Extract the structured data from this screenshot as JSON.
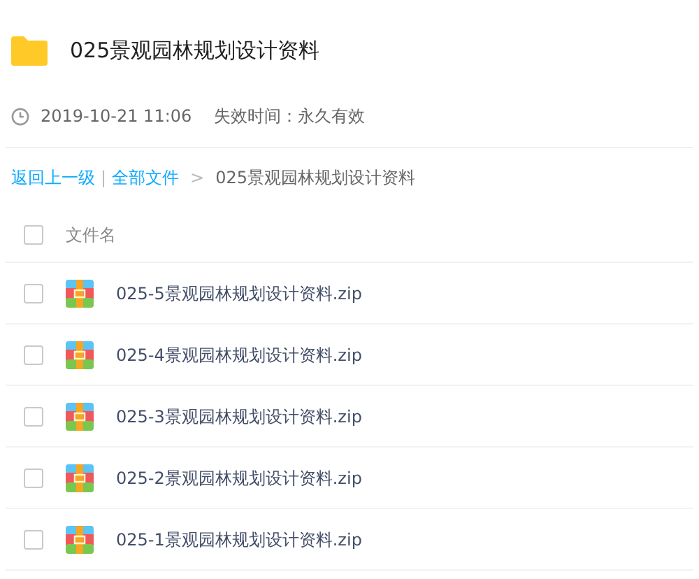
{
  "title": "025景观园林规划设计资料",
  "meta": {
    "date": "2019-10-21 11:06",
    "expiry": "失效时间：永久有效"
  },
  "breadcrumb": {
    "back": "返回上一级",
    "separator": "|",
    "all": "全部文件",
    "arrow": ">",
    "current": "025景观园林规划设计资料"
  },
  "list_header": {
    "label": "文件名",
    "checked": false
  },
  "files": [
    {
      "name": "025-5景观园林规划设计资料.zip",
      "checked": false
    },
    {
      "name": "025-4景观园林规划设计资料.zip",
      "checked": false
    },
    {
      "name": "025-3景观园林规划设计资料.zip",
      "checked": false
    },
    {
      "name": "025-2景观园林规划设计资料.zip",
      "checked": false
    },
    {
      "name": "025-1景观园林规划设计资料.zip",
      "checked": false
    }
  ]
}
